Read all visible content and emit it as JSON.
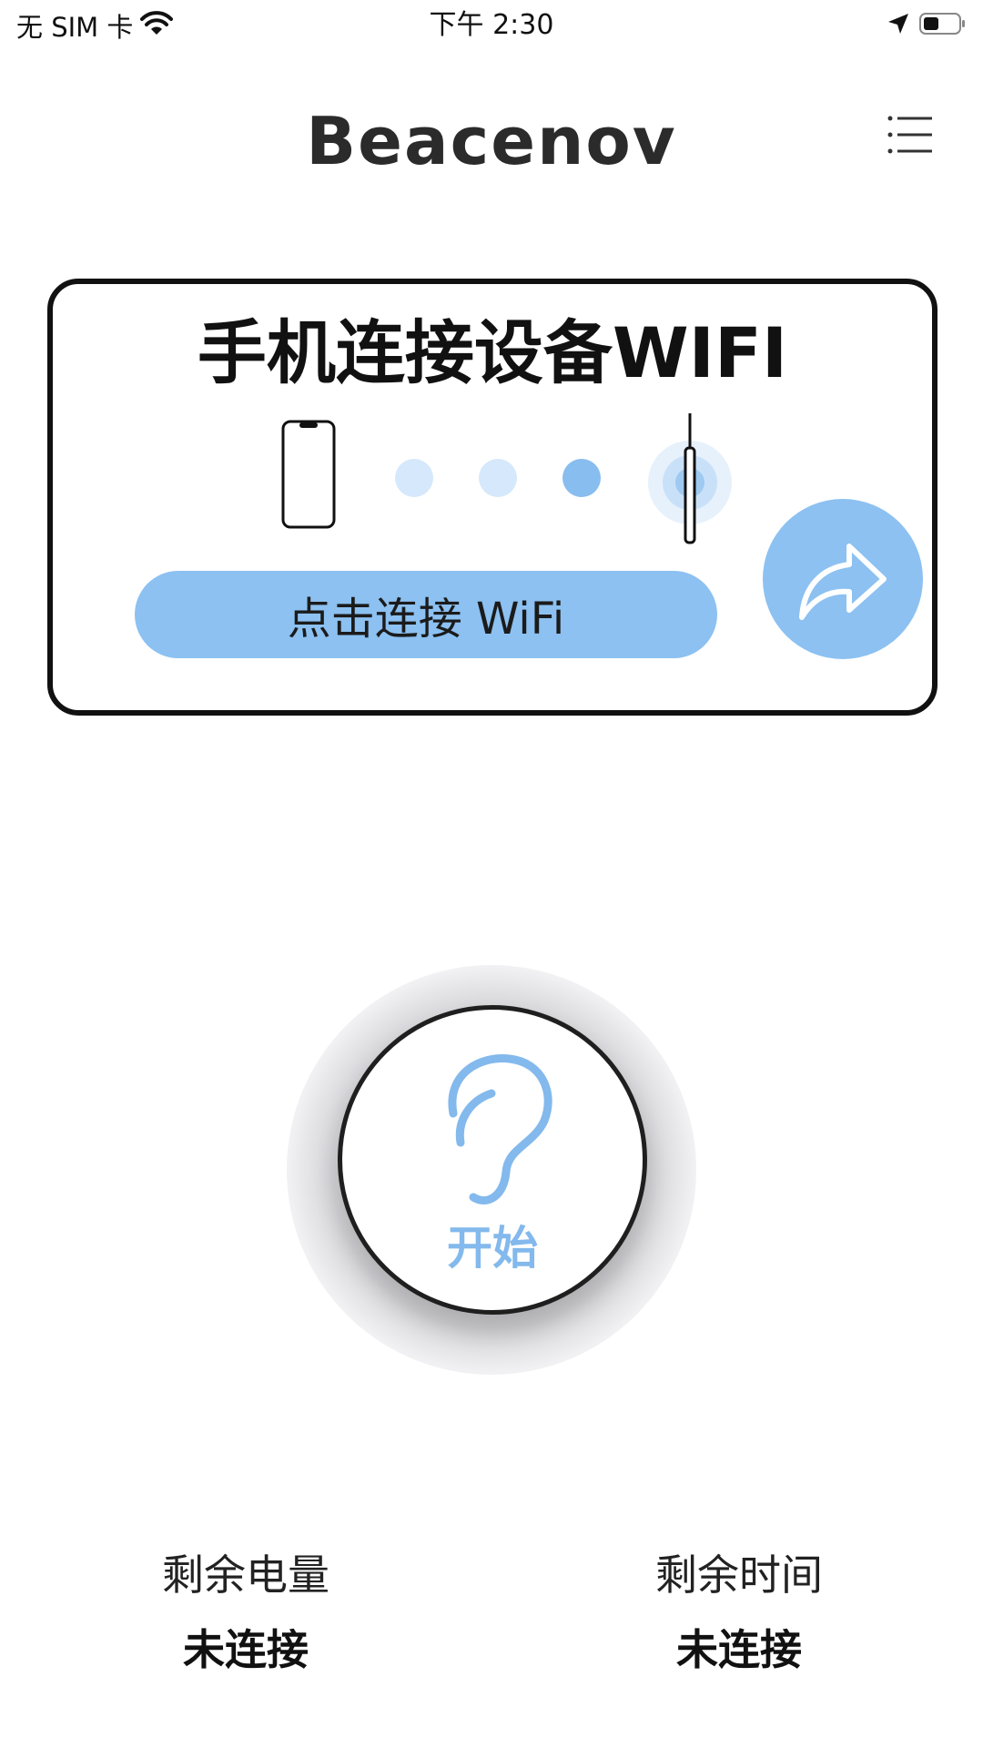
{
  "status_bar": {
    "carrier": "无 SIM 卡",
    "time": "下午 2:30",
    "icons": [
      "wifi-icon",
      "location-arrow-icon",
      "battery-icon"
    ]
  },
  "header": {
    "logo": "Beacenov",
    "menu_icon": "hamburger-menu-icon"
  },
  "wifi_card": {
    "title": "手机连接设备WIFI",
    "connect_button": "点击连接 WiFi",
    "share_icon": "share-arrow-icon"
  },
  "start_button": {
    "label": "开始",
    "icon": "ear-icon"
  },
  "stats": {
    "battery_label": "剩余电量",
    "battery_value": "未连接",
    "time_label": "剩余时间",
    "time_value": "未连接"
  },
  "colors": {
    "accent_blue": "#8cc1f1",
    "dot_light": "#d6e8fb",
    "dot_active": "#88bdef",
    "text_dark": "#111111"
  }
}
